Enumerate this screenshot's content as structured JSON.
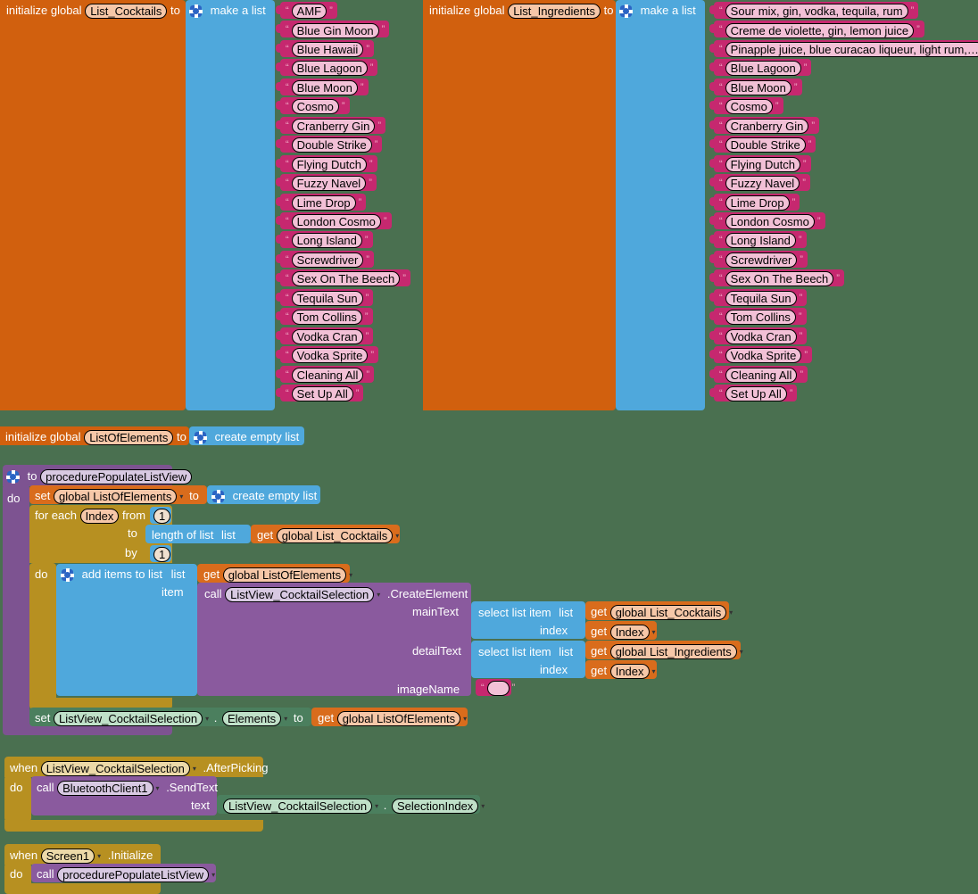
{
  "app": {
    "env": "MIT App Inventor Blocks Editor",
    "background_color": "#4a7050"
  },
  "palette": {
    "variable_orange": "#d1600e",
    "list_blue": "#4fa8dc",
    "text_pink": "#c6286f",
    "control_gold": "#b79021",
    "procedure_purple": "#7d5391",
    "component_green": "#4b7f5e"
  },
  "labels": {
    "initialize_global": "initialize global",
    "to": "to",
    "make_a_list": "make a list",
    "create_empty_list": "create empty list",
    "do": "do",
    "for_each": "for each",
    "from": "from",
    "by": "by",
    "length_of_list": "length of list",
    "list": "list",
    "get": "get",
    "set": "set",
    "add_items_to_list": "add items to list",
    "item": "item",
    "call": "call",
    "select_list_item": "select list item",
    "index": "index",
    "mainText": "mainText",
    "detailText": "detailText",
    "imageName": "imageName",
    "when": "when",
    "text": "text",
    "dot": "."
  },
  "global_cocktails": {
    "name": "List_Cocktails",
    "items": [
      "AMF",
      "Blue Gin Moon",
      "Blue Hawaii",
      "Blue Lagoon",
      "Blue Moon",
      "Cosmo",
      "Cranberry Gin",
      "Double Strike",
      "Flying Dutch",
      "Fuzzy Navel",
      "Lime Drop",
      "London Cosmo",
      "Long Island",
      "Screwdriver",
      "Sex On The Beech",
      "Tequila Sun",
      "Tom Collins",
      "Vodka Cran",
      "Vodka Sprite",
      "Cleaning All",
      "Set Up All"
    ]
  },
  "global_ingredients": {
    "name": "List_Ingredients",
    "items": [
      "Sour mix, gin, vodka, tequila, rum",
      "Creme de violette, gin, lemon juice",
      "Pinapple juice, blue curacao liqueur, light rum,…",
      "Blue Lagoon",
      "Blue Moon",
      "Cosmo",
      "Cranberry Gin",
      "Double Strike",
      "Flying Dutch",
      "Fuzzy Navel",
      "Lime Drop",
      "London Cosmo",
      "Long Island",
      "Screwdriver",
      "Sex On The Beech",
      "Tequila Sun",
      "Tom Collins",
      "Vodka Cran",
      "Vodka Sprite",
      "Cleaning All",
      "Set Up All"
    ]
  },
  "global_elements": {
    "name": "ListOfElements",
    "value_label": "create empty list"
  },
  "procedure": {
    "name": "procedurePopulateListView",
    "set_target": "global ListOfElements",
    "set_value": "create empty list",
    "loop_var": "Index",
    "from_value": "1",
    "by_value": "1",
    "to_list_var": "global List_Cocktails",
    "add_list_var": "global ListOfElements",
    "call_component": "ListView_CocktailSelection",
    "call_method": ".CreateElement",
    "mainText_list": "global List_Cocktails",
    "mainText_index": "Index",
    "detailText_list": "global List_Ingredients",
    "detailText_index": "Index",
    "imageName_value": "",
    "set_component": "ListView_CocktailSelection",
    "set_property": "Elements",
    "set_to_var": "global ListOfElements"
  },
  "event_afterpicking": {
    "component": "ListView_CocktailSelection",
    "event": ".AfterPicking",
    "call_component": "BluetoothClient1",
    "call_method": ".SendText",
    "text_component": "ListView_CocktailSelection",
    "text_property": "SelectionIndex"
  },
  "event_initialize": {
    "component": "Screen1",
    "event": ".Initialize",
    "call_procedure": "procedurePopulateListView"
  }
}
